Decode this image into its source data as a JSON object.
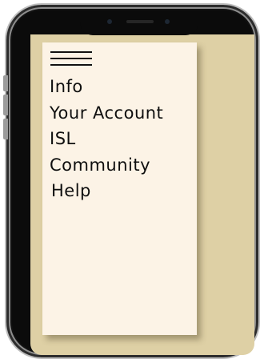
{
  "colors": {
    "screen_background": "#ded0a5",
    "drawer_background": "#fcf3e6",
    "text": "#0f0f0f",
    "phone_frame": "#0b0b0b"
  },
  "menu_icon": "hamburger-icon",
  "menu": {
    "items": [
      {
        "label": "Info"
      },
      {
        "label": "Your Account"
      },
      {
        "label": "ISL"
      },
      {
        "label": "Community"
      },
      {
        "label": "Help"
      }
    ]
  }
}
